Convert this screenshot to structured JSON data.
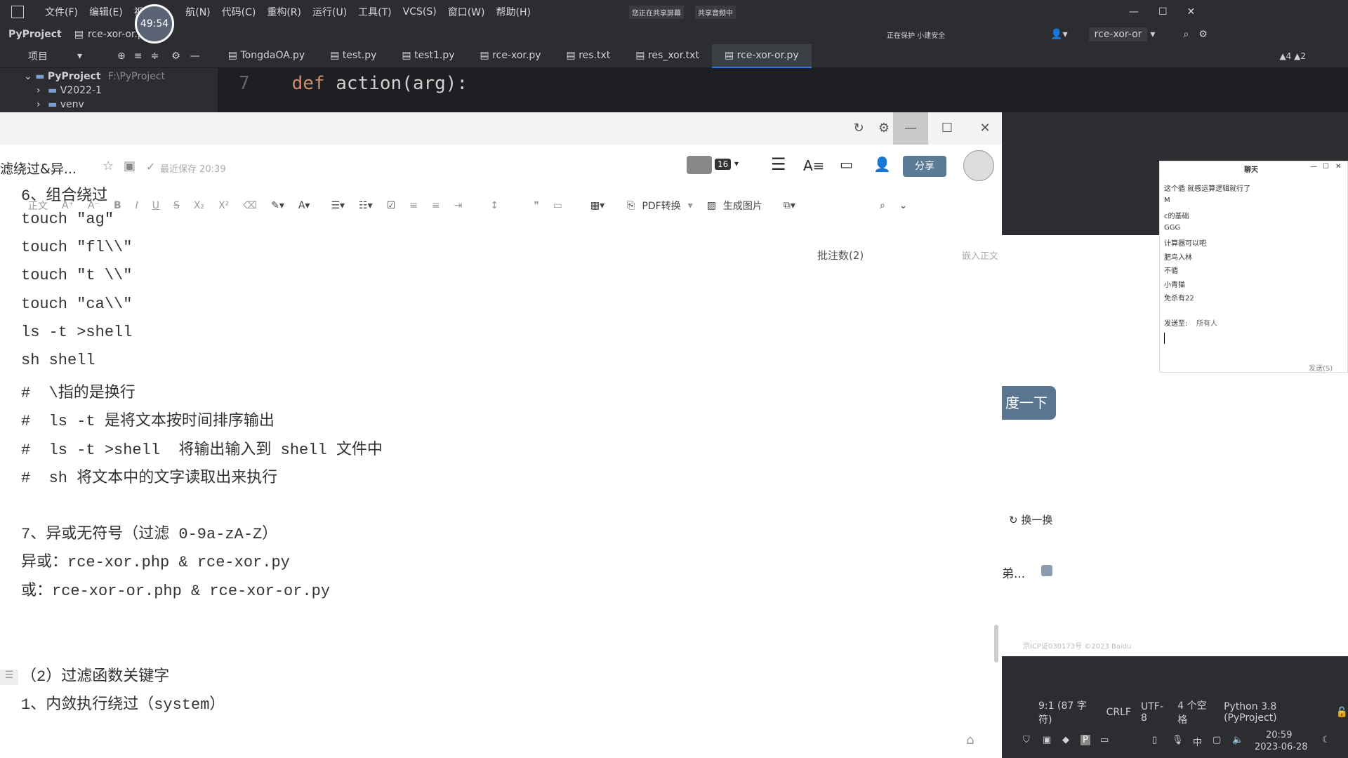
{
  "ide": {
    "menu": [
      "文件(F)",
      "编辑(E)",
      "视图(",
      "航(N)",
      "代码(C)",
      "重构(R)",
      "运行(U)",
      "工具(T)",
      "VCS(S)",
      "窗口(W)",
      "帮助(H)"
    ],
    "project_name": "PyProject",
    "current_file": "rce-xor-or.py",
    "sharing_text": "您正在共享屏幕",
    "audio_text": "共享音频中",
    "project_label": "项目",
    "tabs": [
      {
        "label": "TongdaOA.py",
        "active": false
      },
      {
        "label": "test.py",
        "active": false
      },
      {
        "label": "test1.py",
        "active": false
      },
      {
        "label": "rce-xor.py",
        "active": false
      },
      {
        "label": "res.txt",
        "active": false
      },
      {
        "label": "res_xor.txt",
        "active": false
      },
      {
        "label": "rce-xor-or.py",
        "active": true
      }
    ],
    "run_config": "rce-xor-or",
    "tree": {
      "root": "PyProject",
      "root_path": "F:\\PyProject",
      "items": [
        "V2022-1",
        "venv"
      ]
    },
    "code": {
      "line_no": "7",
      "keyword": "def",
      "text": " action(arg):"
    },
    "warnings": "▲4  ▲2",
    "security_text": "正在保护  小建安全",
    "status": {
      "position": "9:1 (87 字符)",
      "line_ending": "CRLF",
      "encoding": "UTF-8",
      "indent": "4 个空格",
      "interpreter": "Python 3.8 (PyProject)"
    }
  },
  "timer": "49:54",
  "taskbar": {
    "ime": "中",
    "time": "20:59",
    "date": "2023-06-28"
  },
  "doc": {
    "title": "滤绕过&异...",
    "saved": "最近保存 20:39",
    "collab_count": "16",
    "share_label": "分享",
    "pdf_label": "PDF转换",
    "image_label": "生成图片",
    "comments": "批注数(2)",
    "insert": "嵌入正文",
    "lines": [
      "6、组合绕过",
      "touch \"ag\"",
      "touch \"fl\\\\\"",
      "touch \"t \\\\\"",
      "touch \"ca\\\\\"",
      "ls -t >shell",
      "sh shell",
      "#  \\指的是换行",
      "#  ls -t 是将文本按时间排序输出",
      "#  ls -t >shell  将输出输入到 shell 文件中",
      "#  sh 将文本中的文字读取出来执行",
      "",
      "7、异或无符号（过滤 0-9a-zA-Z）",
      "异或：rce-xor.php & rce-xor.py",
      "或：rce-xor-or.php & rce-xor-or.py",
      "",
      "",
      "（2）过滤函数关键字",
      "1、内敛执行绕过（system）"
    ]
  },
  "background_page": {
    "button": "度一下",
    "refresh": "换一换",
    "item": "弟...",
    "footer": "京ICP证030173号 ©2023 Baidu"
  },
  "chat": {
    "title": "聊天",
    "messages": [
      "这个循 就感运算逻辑就行了",
      "M",
      "c的基础",
      "GGG",
      "计算器可以吧",
      "肥鸟入林",
      "不循",
      "小青猫",
      "免杀有22"
    ],
    "send_to_label": "发送至:",
    "send_to_value": "所有人",
    "send_label": "发送(S)"
  }
}
